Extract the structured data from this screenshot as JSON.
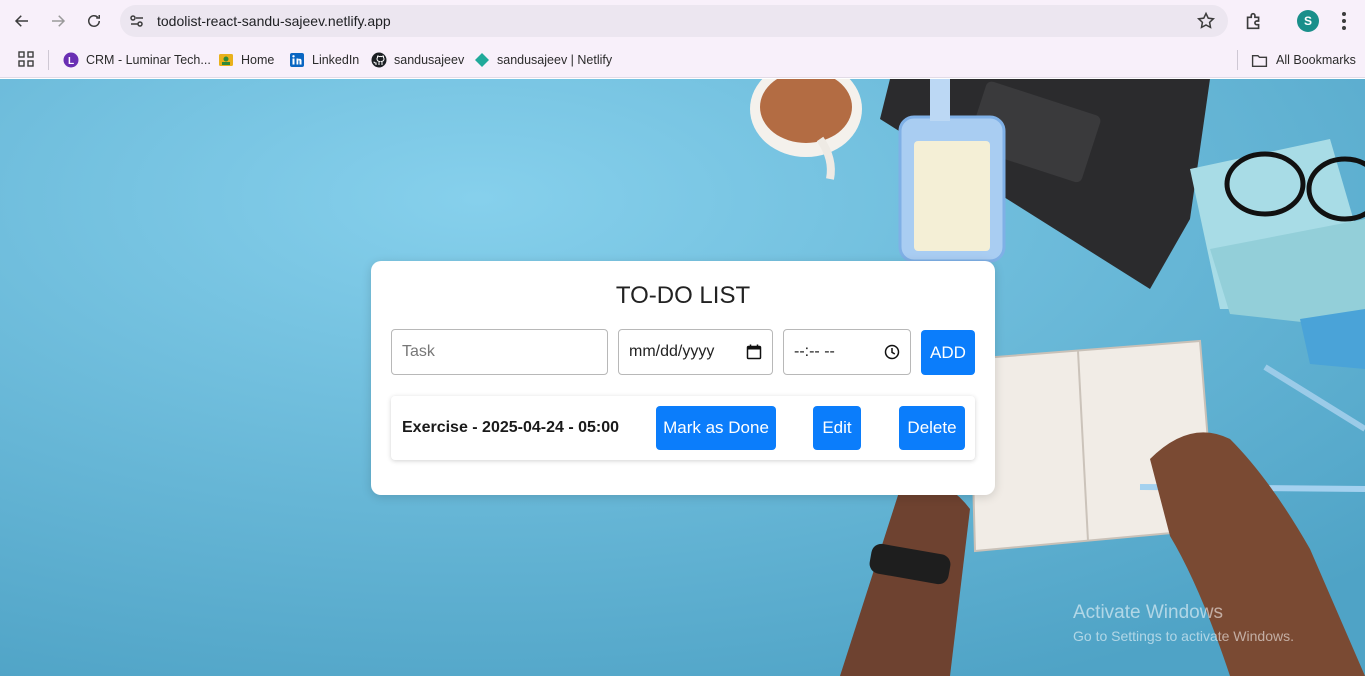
{
  "browser": {
    "url": "todolist-react-sandu-sajeev.netlify.app",
    "profile_initial": "S",
    "bookmarks": [
      {
        "label": "CRM - Luminar Tech...",
        "icon": "luminar-l-icon"
      },
      {
        "label": "Home",
        "icon": "home-image-icon"
      },
      {
        "label": "LinkedIn",
        "icon": "linkedin-icon"
      },
      {
        "label": "sandusajeev",
        "icon": "github-icon"
      },
      {
        "label": "sandusajeev | Netlify",
        "icon": "netlify-icon"
      }
    ],
    "all_bookmarks": "All Bookmarks"
  },
  "app": {
    "title": "TO-DO LIST",
    "task_placeholder": "Task",
    "date_placeholder": "mm/dd/yyyy",
    "time_placeholder": "--:-- --",
    "add_label": "ADD",
    "tasks": [
      {
        "text": "Exercise - 2025-04-24 - 05:00",
        "done_label": "Mark as Done",
        "edit_label": "Edit",
        "delete_label": "Delete"
      }
    ]
  },
  "watermark": {
    "line1": "Activate Windows",
    "line2": "Go to Settings to activate Windows."
  },
  "colors": {
    "accent": "#0b7dfb",
    "background": "#72c0de",
    "chrome": "#f8f0fa"
  }
}
